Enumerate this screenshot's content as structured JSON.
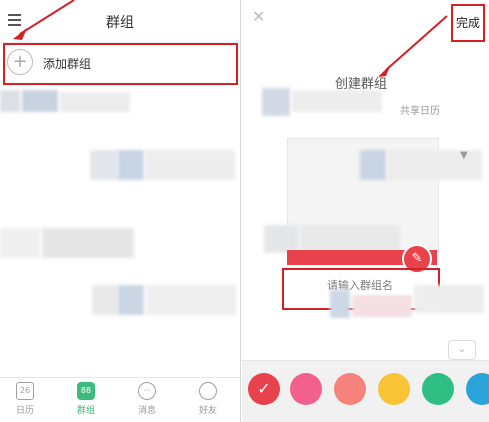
{
  "left": {
    "title": "群组",
    "add_group_label": "添加群组",
    "tabs": [
      {
        "icon_text": "26",
        "label": "日历",
        "active": false
      },
      {
        "icon_text": "88",
        "label": "群组",
        "active": true
      },
      {
        "icon_text": "···",
        "label": "消息",
        "active": false
      },
      {
        "icon_text": "",
        "label": "好友",
        "active": false
      }
    ]
  },
  "right": {
    "done_label": "完成",
    "create_heading": "创建群组",
    "share_caption": "共享日历",
    "name_placeholder": "请输入群组名",
    "colors": [
      "#e8424c",
      "#f2608e",
      "#f5837b",
      "#f8c334",
      "#2fbf85",
      "#2aa4d8"
    ]
  },
  "colors": {
    "accent_green": "#3dbb7e",
    "annotation_red": "#d71f26"
  }
}
